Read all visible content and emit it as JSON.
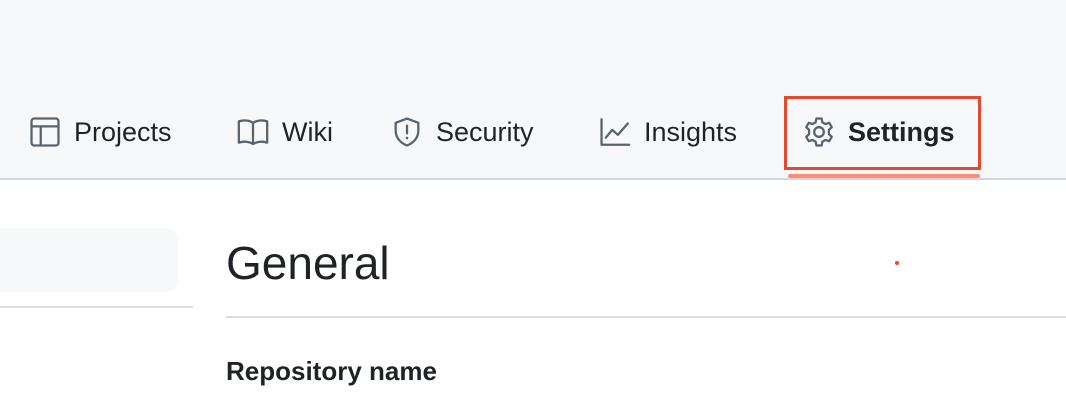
{
  "repo_nav": {
    "tabs": [
      {
        "label": "Projects",
        "icon": "table-icon"
      },
      {
        "label": "Wiki",
        "icon": "book-icon"
      },
      {
        "label": "Security",
        "icon": "shield-icon"
      },
      {
        "label": "Insights",
        "icon": "graph-icon"
      },
      {
        "label": "Settings",
        "icon": "gear-icon",
        "selected": true
      }
    ]
  },
  "main": {
    "title": "General",
    "repository_name_label": "Repository name"
  },
  "colors": {
    "header_bg": "#f6f8fa",
    "highlight": "#e5492f",
    "selected_underline": "#fd8c73",
    "text": "#1f2328",
    "icon": "#59636e"
  }
}
